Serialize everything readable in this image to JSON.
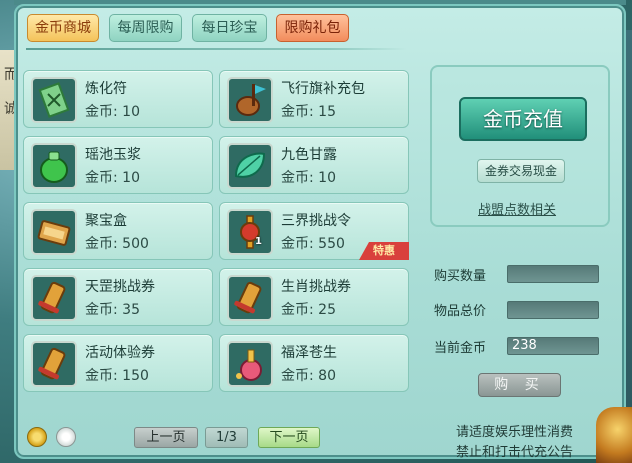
{
  "tabs": [
    {
      "label": "金币商城",
      "state": "active"
    },
    {
      "label": "每周限购",
      "state": "normal"
    },
    {
      "label": "每日珍宝",
      "state": "normal"
    },
    {
      "label": "限购礼包",
      "state": "gift"
    }
  ],
  "items": [
    {
      "name": "炼化符",
      "price": "金币: 10",
      "icon": "talisman-icon",
      "qty": "",
      "badge": ""
    },
    {
      "name": "飞行旗补充包",
      "price": "金币: 15",
      "icon": "flag-pack-icon",
      "qty": "",
      "badge": ""
    },
    {
      "name": "瑶池玉浆",
      "price": "金币: 10",
      "icon": "jade-jar-icon",
      "qty": "",
      "badge": ""
    },
    {
      "name": "九色甘露",
      "price": "金币: 10",
      "icon": "dew-leaf-icon",
      "qty": "",
      "badge": ""
    },
    {
      "name": "聚宝盒",
      "price": "金币: 500",
      "icon": "treasure-box-icon",
      "qty": "",
      "badge": ""
    },
    {
      "name": "三界挑战令",
      "price": "金币: 550",
      "icon": "challenge-token-icon",
      "qty": "1",
      "badge": "特惠"
    },
    {
      "name": "天罡挑战券",
      "price": "金币: 35",
      "icon": "scroll-icon",
      "qty": "",
      "badge": ""
    },
    {
      "name": "生肖挑战券",
      "price": "金币: 25",
      "icon": "scroll-icon",
      "qty": "",
      "badge": ""
    },
    {
      "name": "活动体验券",
      "price": "金币: 150",
      "icon": "scroll-icon",
      "qty": "",
      "badge": ""
    },
    {
      "name": "福泽苍生",
      "price": "金币: 80",
      "icon": "potion-bottle-icon",
      "qty": "",
      "badge": ""
    }
  ],
  "recharge": {
    "button_label": "金币充值",
    "exchange_label": "金券交易现金",
    "link_label": "战盟点数相关"
  },
  "purchase": {
    "qty_label": "购买数量",
    "qty_value": "",
    "total_label": "物品总价",
    "total_value": "",
    "current_label": "当前金币",
    "current_value": "238",
    "buy_label": "购 买"
  },
  "pagination": {
    "prev_label": "上一页",
    "page_indicator": "1/3",
    "next_label": "下一页"
  },
  "notice": {
    "line1": "请适度娱乐理性消费",
    "line2": "禁止和打击代充公告"
  },
  "side_text": [
    "而",
    "诚"
  ],
  "colors": {
    "panel": "#a9ddd6",
    "tab_active": "#f4c35a",
    "tab_gift": "#f28c5c",
    "recharge_button": "#218f7a",
    "badge": "#d9403c"
  }
}
